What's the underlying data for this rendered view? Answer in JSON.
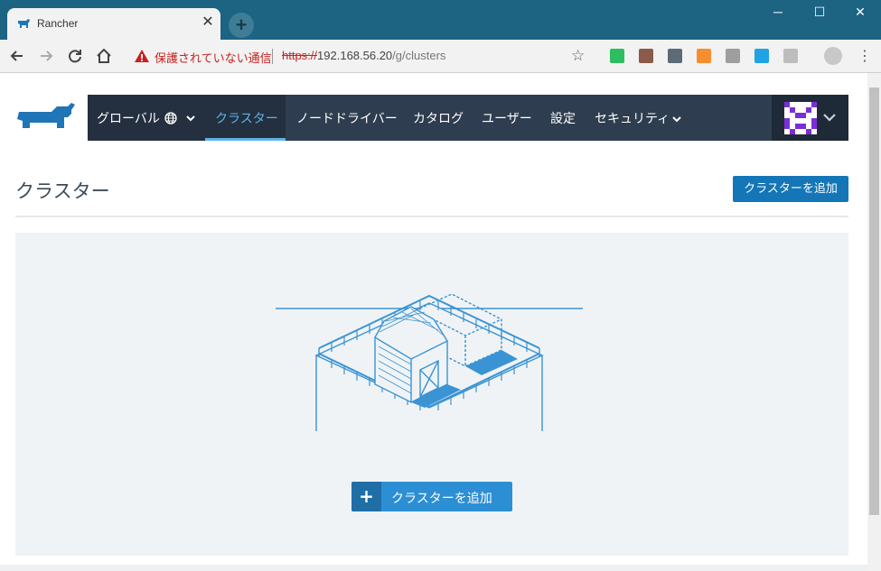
{
  "browser": {
    "tab_title": "Rancher",
    "tab_close": "✕",
    "new_tab": "+",
    "security_text": "保護されていない通信",
    "url_scheme": "https://",
    "url_host": "192.168.56.20",
    "url_path": "/g/clusters",
    "window_controls": [
      "─",
      "☐",
      "✕"
    ],
    "extensions": [
      {
        "name": "evernote-icon",
        "color": "#2dbe60"
      },
      {
        "name": "pdf-icon",
        "color": "#8a5a4a"
      },
      {
        "name": "acrobat-icon",
        "color": "#5d6b78"
      },
      {
        "name": "d3-icon",
        "color": "#f68e2f"
      },
      {
        "name": "g-icon",
        "color": "#9e9e9e"
      },
      {
        "name": "windows-icon",
        "color": "#1fa3e5"
      },
      {
        "name": "circle-icon",
        "color": "#bdbdbd"
      }
    ]
  },
  "nav": {
    "global_label": "グローバル",
    "items": [
      "クラスター",
      "ノードドライバー",
      "カタログ",
      "ユーザー",
      "設定",
      "セキュリティ"
    ]
  },
  "page": {
    "title": "クラスター",
    "add_cluster_top": "クラスターを追加",
    "add_cluster_main": "クラスターを追加",
    "plus": "+"
  },
  "colors": {
    "chrome_title": "#1d6382",
    "navbar": "#2e3d4f",
    "accent": "#5bb4e6",
    "primary_button": "#1476b6",
    "illustration": "#3a94d4"
  }
}
